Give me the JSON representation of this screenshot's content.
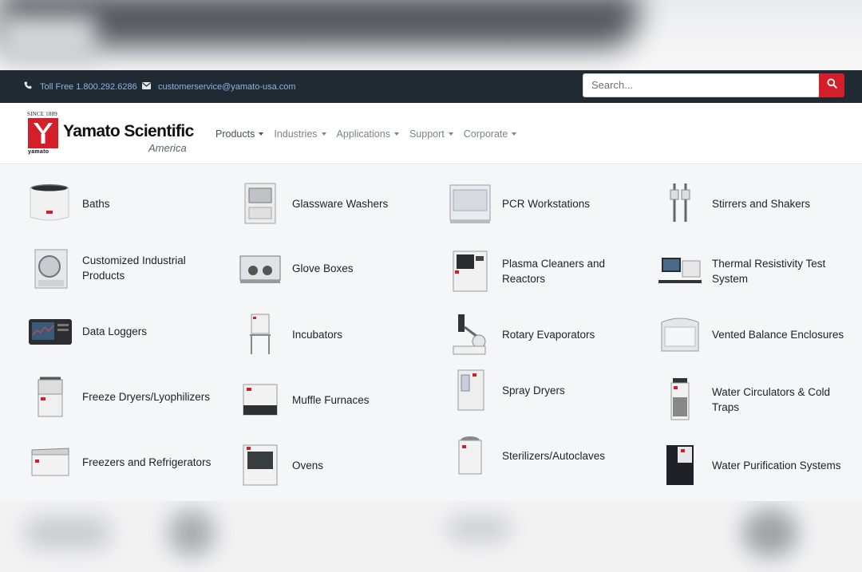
{
  "topbar": {
    "phone": "Toll Free 1.800.292.6286",
    "email": "customerservice@yamato-usa.com",
    "search_placeholder": "Search..."
  },
  "logo": {
    "since": "SINCE 1889",
    "brand": "Yamato Scientific",
    "sub": "America",
    "small": "yamato"
  },
  "nav": [
    "Products",
    "Industries",
    "Applications",
    "Support",
    "Corporate"
  ],
  "menu": {
    "columns": [
      [
        "Baths",
        "Customized Industrial Products",
        "Data Loggers",
        "Freeze Dryers/Lyophilizers",
        "Freezers and Refrigerators"
      ],
      [
        "Glassware Washers",
        "Glove Boxes",
        "Incubators",
        "Muffle Furnaces",
        "Ovens"
      ],
      [
        "PCR Workstations",
        "Plasma Cleaners and Reactors",
        "Rotary Evaporators",
        "Spray Dryers",
        "Sterilizers/Autoclaves"
      ],
      [
        "Stirrers and Shakers",
        "Thermal Resistivity Test System",
        "Vented Balance Enclosures",
        "Water Circulators & Cold Traps",
        "Water Purification Systems"
      ]
    ]
  },
  "colors": {
    "topbar_bg": "#1f2a33",
    "accent_red": "#d21f2a",
    "link_blue": "#8fb4df",
    "menu_bg": "#f5f6f8"
  },
  "icons": {
    "phone": "phone-icon",
    "email": "envelope-icon",
    "search": "search-icon"
  }
}
